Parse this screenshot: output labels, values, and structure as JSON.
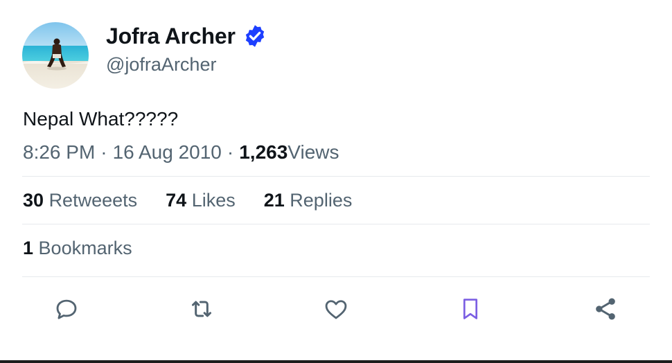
{
  "tweet": {
    "display_name": "Jofra Archer",
    "handle": "@jofraArcher",
    "text": "Nepal What?????",
    "time": "8:26 PM",
    "date": "16 Aug 2010",
    "separator": "·",
    "views_count": "1,263",
    "views_label": "Views"
  },
  "stats": {
    "retweets_count": "30",
    "retweets_label": "Retweeets",
    "likes_count": "74",
    "likes_label": "Likes",
    "replies_count": "21",
    "replies_label": "Replies",
    "bookmarks_count": "1",
    "bookmarks_label": "Bookmarks"
  },
  "actions": [
    "reply-icon",
    "retweet-icon",
    "like-icon",
    "bookmark-icon",
    "share-icon"
  ],
  "colors": {
    "text_primary": "#0f1419",
    "text_secondary": "#536471",
    "verified_badge": "#1d3fff",
    "bookmark_accent": "#7b5fe3",
    "divider": "#e6e9ec"
  }
}
